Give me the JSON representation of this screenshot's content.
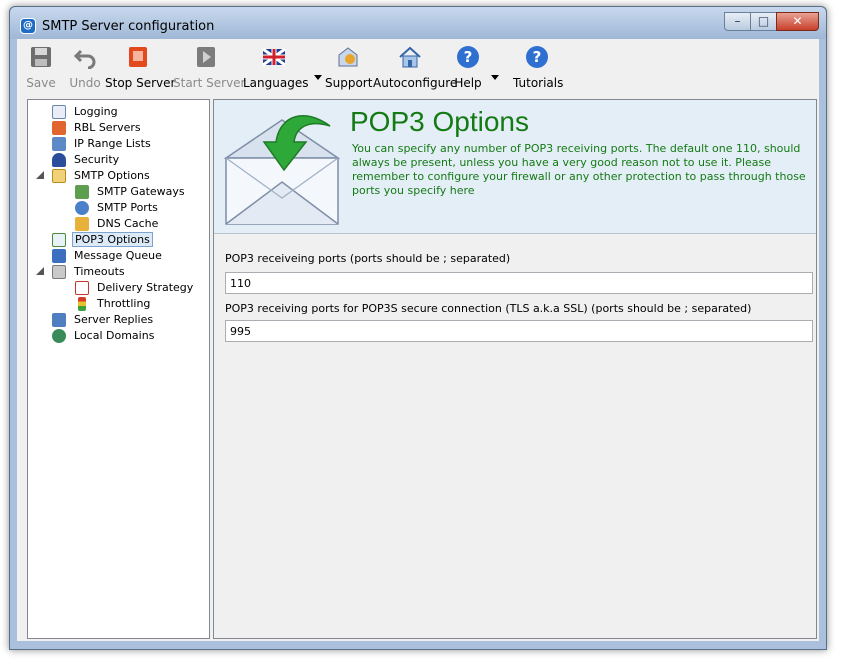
{
  "window": {
    "title": "SMTP Server configuration"
  },
  "toolbar": {
    "save": "Save",
    "undo": "Undo",
    "stop_server": "Stop Server",
    "start_server": "Start Server",
    "languages": "Languages",
    "support": "Support",
    "autoconfigure": "Autoconfigure",
    "help": "Help",
    "tutorials": "Tutorials"
  },
  "tree": {
    "items": [
      {
        "label": "Logging",
        "icon": "log-icon"
      },
      {
        "label": "RBL Servers",
        "icon": "rbl-icon"
      },
      {
        "label": "IP Range Lists",
        "icon": "ip-icon"
      },
      {
        "label": "Security",
        "icon": "user-icon"
      },
      {
        "label": "SMTP Options",
        "icon": "mail-lock-icon"
      },
      {
        "label": "SMTP Gateways",
        "icon": "gateway-icon"
      },
      {
        "label": "SMTP Ports",
        "icon": "ports-icon"
      },
      {
        "label": "DNS Cache",
        "icon": "cache-icon"
      },
      {
        "label": "POP3 Options",
        "icon": "pop3-icon"
      },
      {
        "label": "Message Queue",
        "icon": "queue-icon"
      },
      {
        "label": "Timeouts",
        "icon": "timeouts-icon"
      },
      {
        "label": "Delivery Strategy",
        "icon": "calendar-icon"
      },
      {
        "label": "Throttling",
        "icon": "traffic-light-icon"
      },
      {
        "label": "Server Replies",
        "icon": "replies-icon"
      },
      {
        "label": "Local Domains",
        "icon": "globe-icon"
      }
    ],
    "selected": "POP3 Options"
  },
  "main": {
    "title": "POP3 Options",
    "description": "You can specify any number of POP3 receiving ports. The default one 110, should always be present, unless you have a very good reason not to use it. Please remember to configure your firewall or any other protection to pass through those ports you specify here",
    "pop3_label": "POP3 receiveing ports (ports should be ; separated)",
    "pop3_value": "110",
    "pop3s_label": "POP3 receiving ports for POP3S secure connection (TLS a.k.a SSL)  (ports should be ; separated)",
    "pop3s_value": "995"
  },
  "colors": {
    "title_green": "#147a14",
    "header_bg": "#e4eef7",
    "selection": "#dceaf7"
  }
}
